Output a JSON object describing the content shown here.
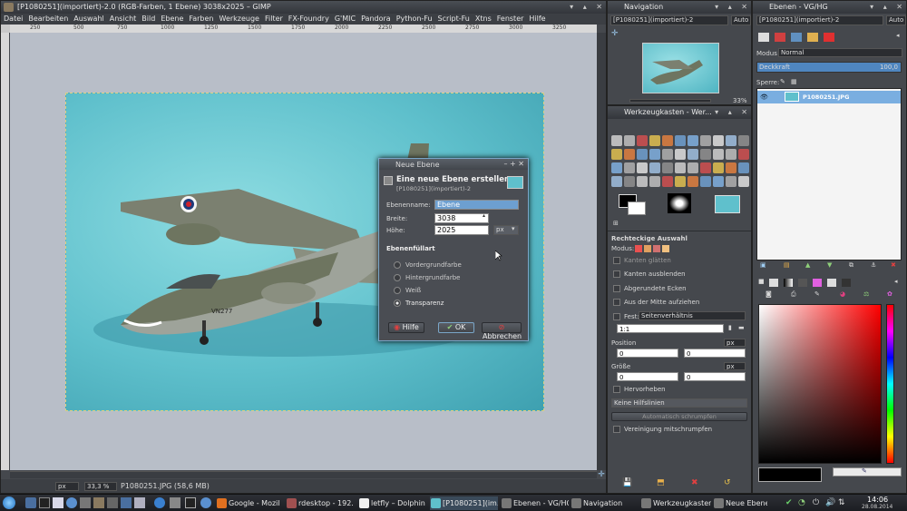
{
  "gimp": {
    "title": "[P1080251](importiert)-2.0 (RGB-Farben, 1 Ebene) 3038x2025 – GIMP",
    "menu": [
      "Datei",
      "Bearbeiten",
      "Auswahl",
      "Ansicht",
      "Bild",
      "Ebene",
      "Farben",
      "Werkzeuge",
      "Filter",
      "FX-Foundry",
      "G'MIC",
      "Pandora",
      "Python-Fu",
      "Script-Fu",
      "Xtns",
      "Fenster",
      "Hilfe"
    ],
    "ruler_ticks": [
      "250",
      "500",
      "750",
      "1000",
      "1250",
      "1500",
      "1750",
      "2000",
      "2250",
      "2500",
      "2750",
      "3000",
      "3250"
    ],
    "unit": "px",
    "zoom": "33,3 %",
    "status": "P1080251.JPG (58,6 MB)",
    "plane_code": "VN277"
  },
  "dialog": {
    "window_title": "Neue Ebene",
    "heading": "Eine neue Ebene erstellen",
    "subheading": "[P1080251](importiert)-2",
    "name_label": "Ebenenname:",
    "name_value": "Ebene",
    "width_label": "Breite:",
    "width_value": "3038",
    "height_label": "Höhe:",
    "height_value": "2025",
    "unit": "px",
    "fill_heading": "Ebenenfüllart",
    "fill_options": [
      "Vordergrundfarbe",
      "Hintergrundfarbe",
      "Weiß",
      "Transparenz"
    ],
    "selected_fill": "Transparenz",
    "help_label": "Hilfe",
    "ok_label": "OK",
    "cancel_label": "Abbrechen"
  },
  "navigation": {
    "title": "Navigation",
    "image_select": "[P1080251](importiert)-2",
    "auto_label": "Auto",
    "zoom_readout": "33%"
  },
  "toolbox": {
    "title": "Werkzeugkasten - Wer...",
    "tool_options_title": "Rechteckige Auswahl",
    "mode_label": "Modus:",
    "options": {
      "antialias": "Kanten glätten",
      "feather": "Kanten ausblenden",
      "rounded": "Abgerundete Ecken",
      "expand_center": "Aus der Mitte aufziehen",
      "fixed_label": "Fest:",
      "fixed_value": "Seitenverhältnis",
      "ratio_value": "1:1",
      "position_label": "Position",
      "position_unit": "px",
      "pos_x": "0",
      "pos_y": "0",
      "size_label": "Größe",
      "size_unit": "px",
      "size_w": "0",
      "size_h": "0",
      "highlight": "Hervorheben",
      "guides": "Keine Hilfslinien",
      "auto_shrink": "Automatisch schrumpfen",
      "shrink_merged": "Vereinigung mitschrumpfen"
    }
  },
  "layers": {
    "title": "Ebenen - VG/HG",
    "image_select": "[P1080251](importiert)-2",
    "auto_label": "Auto",
    "mode_label": "Modus",
    "mode_value": "Normal",
    "opacity_label": "Deckkraft",
    "opacity_value": "100,0",
    "lock_label": "Sperre:",
    "layer_name": "P1080251.JPG"
  },
  "taskbar": {
    "items": [
      "Google - Mozil...",
      "rdesktop - 192...",
      "letfly – Dolphin",
      "[P1080251](im...",
      "Ebenen - VG/HG",
      "Navigation",
      "Werkzeugkasten",
      "Neue Ebene"
    ],
    "time": "14:06",
    "date": "28.08.2014"
  },
  "colors": {
    "canvas_bg": "#b8bec8",
    "photo_bg": "#5fc0cc",
    "accent": "#6d9fd0",
    "panel": "#45484d"
  }
}
